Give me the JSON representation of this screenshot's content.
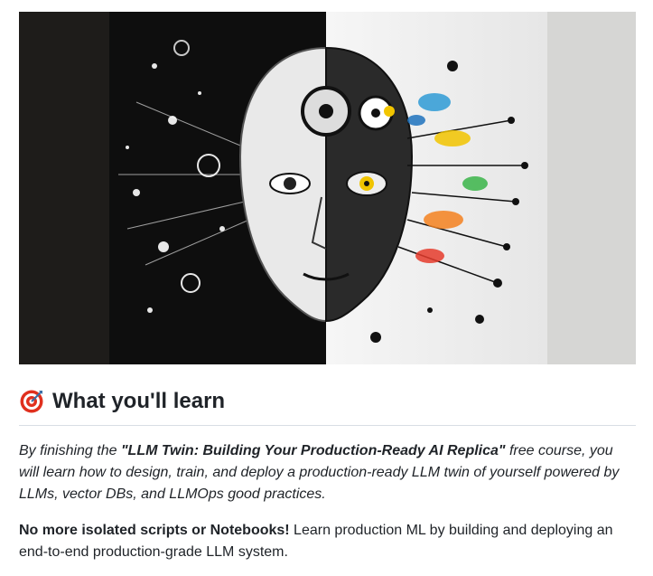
{
  "hero_image": {
    "alt": "Half human, half robotic face illustration"
  },
  "section": {
    "emoji_icon": "target-icon",
    "heading": "What you'll learn"
  },
  "intro": {
    "prefix": "By finishing the ",
    "course_title": "\"LLM Twin: Building Your Production-Ready AI Replica\"",
    "suffix": " free course, you will learn how to design, train, and deploy a production-ready LLM twin of yourself powered by LLMs, vector DBs, and LLMOps good practices."
  },
  "callout": {
    "bold": "No more isolated scripts or Notebooks!",
    "text": " Learn production ML by building and deploying an end-to-end production-grade LLM system."
  },
  "colors": {
    "text": "#1f2328",
    "rule": "#d8dee4",
    "target_red": "#e0301e"
  }
}
